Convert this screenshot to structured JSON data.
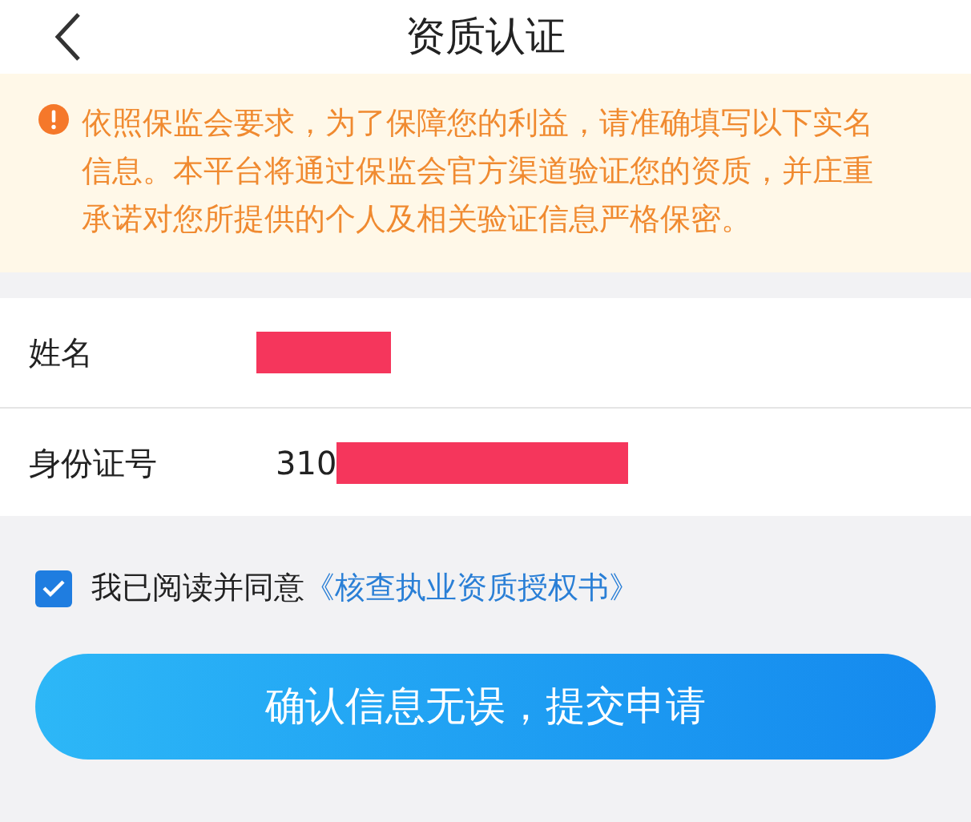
{
  "header": {
    "title": "资质认证"
  },
  "notice": {
    "text": "依照保监会要求，为了保障您的利益，请准确填写以下实名信息。本平台将通过保监会官方渠道验证您的资质，并庄重承诺对您所提供的个人及相关验证信息严格保密。"
  },
  "fields": [
    {
      "label": "姓名"
    },
    {
      "label": "身份证号",
      "value": "310"
    }
  ],
  "agreement": {
    "checked": true,
    "text": "我已阅读并同意",
    "link": "《核查执业资质授权书》"
  },
  "submit_button": "确认信息无误，提交申请"
}
